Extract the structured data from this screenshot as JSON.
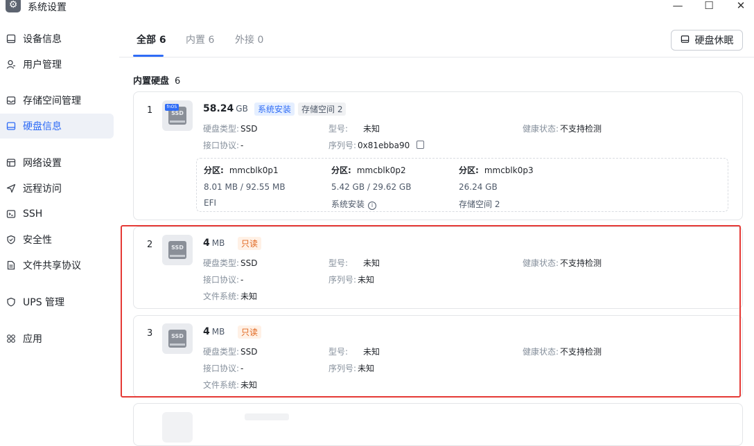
{
  "window": {
    "title": "系统设置",
    "minimize": "—",
    "maximize": "☐",
    "close": "✕",
    "app_icon": "gear-icon"
  },
  "sidebar": {
    "items": [
      {
        "label": "设备信息",
        "icon": "device-info-icon"
      },
      {
        "label": "用户管理",
        "icon": "user-icon"
      },
      {
        "label": "存储空间管理",
        "icon": "storage-icon"
      },
      {
        "label": "硬盘信息",
        "icon": "disk-icon",
        "active": true
      },
      {
        "label": "网络设置",
        "icon": "network-icon"
      },
      {
        "label": "远程访问",
        "icon": "remote-icon"
      },
      {
        "label": "SSH",
        "icon": "terminal-icon"
      },
      {
        "label": "安全性",
        "icon": "shield-icon"
      },
      {
        "label": "文件共享协议",
        "icon": "file-icon"
      },
      {
        "label": "UPS 管理",
        "icon": "ups-icon"
      },
      {
        "label": "应用",
        "icon": "apps-icon"
      }
    ]
  },
  "tabs": [
    {
      "label": "全部 6",
      "active": true
    },
    {
      "label": "内置 6"
    },
    {
      "label": "外接 0"
    }
  ],
  "sleep_button": {
    "label": "硬盘休眠",
    "icon": "disk-icon"
  },
  "section": {
    "title": "内置硬盘",
    "count": "6"
  },
  "labels": {
    "disk_type": "硬盘类型:",
    "interface": "接口协议:",
    "model": "型号:",
    "serial": "序列号:",
    "health": "健康状态:",
    "filesystem": "文件系统:",
    "partition": "分区:"
  },
  "disks": [
    {
      "index": "1",
      "size": "58.24",
      "unit": "GB",
      "icon_text": "SSD",
      "brand": "fnOS",
      "tags": [
        "系统安装",
        "存储空间 2"
      ],
      "disk_type": "SSD",
      "interface": "-",
      "model": "未知",
      "serial": "0x81ebba90",
      "health": "不支持检测",
      "partitions": [
        {
          "name": "mmcblk0p1",
          "size": "8.01 MB / 92.55 MB",
          "usage": "EFI"
        },
        {
          "name": "mmcblk0p2",
          "size": "5.42 GB / 29.62 GB",
          "usage": "系统安装"
        },
        {
          "name": "mmcblk0p3",
          "size": "26.24 GB",
          "usage": "存储空间 2"
        }
      ]
    },
    {
      "index": "2",
      "size": "4",
      "unit": "MB",
      "icon_text": "SSD",
      "tags": [
        "只读"
      ],
      "disk_type": "SSD",
      "interface": "-",
      "model": "未知",
      "serial": "未知",
      "health": "不支持检测",
      "filesystem": "未知"
    },
    {
      "index": "3",
      "size": "4",
      "unit": "MB",
      "icon_text": "SSD",
      "tags": [
        "只读"
      ],
      "disk_type": "SSD",
      "interface": "-",
      "model": "未知",
      "serial": "未知",
      "health": "不支持检测",
      "filesystem": "未知"
    }
  ],
  "colors": {
    "accent": "#2f6cf6",
    "highlight": "#e53935",
    "readonly_tag": "#e0661e"
  }
}
